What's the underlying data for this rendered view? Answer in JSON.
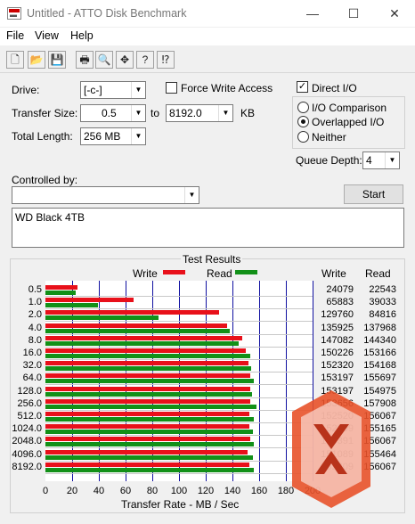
{
  "window": {
    "title": "Untitled - ATTO Disk Benchmark",
    "min": "—",
    "max": "☐",
    "close": "✕"
  },
  "menu": [
    "File",
    "View",
    "Help"
  ],
  "toolbar": [
    "🗋",
    "📂",
    "💾",
    "🖶",
    "🔍",
    "✥",
    "?",
    "⁉"
  ],
  "settings": {
    "drive_label": "Drive:",
    "drive_value": "[-c-]",
    "transfer_label": "Transfer Size:",
    "transfer_from": "0.5",
    "to_label": "to",
    "transfer_to": "8192.0",
    "unit": "KB",
    "length_label": "Total Length:",
    "length_value": "256 MB",
    "force_write_label": "Force Write Access",
    "force_write_checked": false,
    "direct_io_label": "Direct I/O",
    "direct_io_checked": true,
    "io_comparison_label": "I/O Comparison",
    "overlapped_label": "Overlapped I/O",
    "neither_label": "Neither",
    "selected_mode": "overlapped",
    "queue_label": "Queue Depth:",
    "queue_value": "4",
    "controlled_label": "Controlled by:",
    "controlled_value": "",
    "start_label": "Start",
    "description": "WD Black 4TB"
  },
  "results": {
    "group_title": "Test Results",
    "legend_write": "Write",
    "legend_read": "Read",
    "col_write": "Write",
    "col_read": "Read",
    "xlabel": "Transfer Rate - MB / Sec",
    "colors": {
      "write": "#e8101a",
      "read": "#129018"
    }
  },
  "chart_data": {
    "type": "bar",
    "orientation": "horizontal",
    "categories": [
      "0.5",
      "1.0",
      "2.0",
      "4.0",
      "8.0",
      "16.0",
      "32.0",
      "64.0",
      "128.0",
      "256.0",
      "512.0",
      "1024.0",
      "2048.0",
      "4096.0",
      "8192.0"
    ],
    "series": [
      {
        "name": "Write",
        "values": [
          24079,
          65883,
          129760,
          135925,
          147082,
          150226,
          152320,
          153197,
          153197,
          153656,
          152520,
          152809,
          153391,
          151089,
          152809
        ]
      },
      {
        "name": "Read",
        "values": [
          22543,
          39033,
          84816,
          137968,
          144340,
          153166,
          154168,
          155697,
          154975,
          157908,
          156067,
          155165,
          156067,
          155464,
          156067
        ]
      }
    ],
    "xlabel": "Transfer Rate - MB / Sec",
    "xlim": [
      0,
      200
    ],
    "xticks": [
      "0",
      "20",
      "40",
      "60",
      "80",
      "100",
      "120",
      "140",
      "160",
      "180",
      "200"
    ]
  }
}
